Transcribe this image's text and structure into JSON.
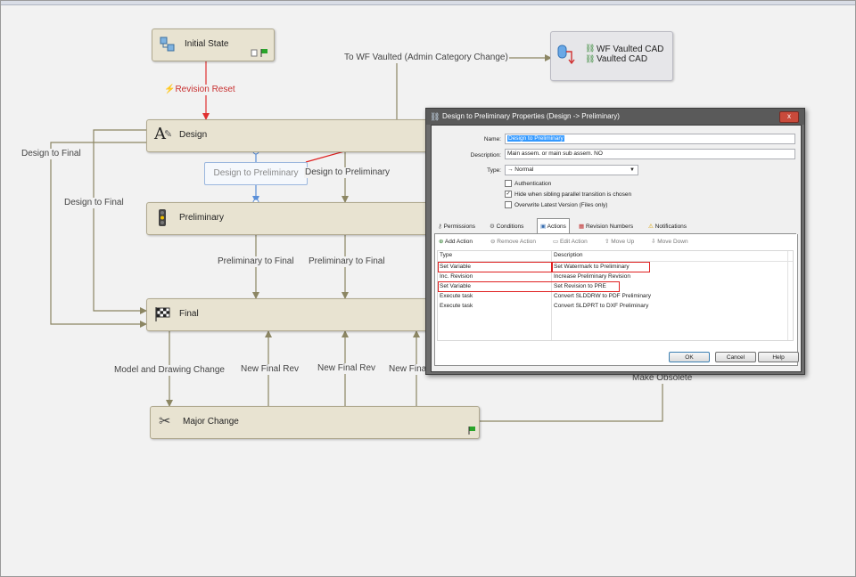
{
  "workflow": {
    "states": {
      "initial_state": "Initial State",
      "design": "Design",
      "preliminary": "Preliminary",
      "final": "Final",
      "major_change": "Major Change"
    },
    "vault_box": {
      "line1": "WF Vaulted CAD",
      "line2": "Vaulted CAD"
    },
    "transitions": {
      "revision_reset": "Revision Reset",
      "to_wf_vaulted": "To WF Vaulted (Admin Category Change)",
      "design_to_final_left": "Design to Final",
      "design_to_final_inner": "Design to Final",
      "design_to_preliminary_selected": "Design to Preliminary",
      "design_to_preliminary": "Design to Preliminary",
      "preliminary_to_final_1": "Preliminary to Final",
      "preliminary_to_final_2": "Preliminary to Final",
      "model_and_drawing_change": "Model and Drawing Change",
      "new_final_rev_1": "New Final Rev",
      "new_final_rev_2": "New Final Rev",
      "new_final_rev_3": "New Fina",
      "make_obsolete": "Make Obsolete"
    },
    "colors": {
      "state_fill": "#e8e3d1",
      "connector": "#8c8663",
      "revision_reset": "#e03030",
      "highlight": "#e02020",
      "selection": "#5a8fd8"
    }
  },
  "dialog": {
    "title": "Design to Preliminary Properties (Design -> Preliminary)",
    "close_label": "x",
    "fields": {
      "name_label": "Name:",
      "name_value": "Design to Preliminary",
      "description_label": "Description:",
      "description_value": "Main assem. or main sub assem. NO",
      "type_label": "Type:",
      "type_value": "→ Normal"
    },
    "checkboxes": [
      {
        "label": "Authentication",
        "checked": false
      },
      {
        "label": "Hide when sibling parallel transition is chosen",
        "checked": true
      },
      {
        "label": "Overwrite Latest Version (Files only)",
        "checked": false
      }
    ],
    "tabs": [
      "Permissions",
      "Conditions",
      "Actions",
      "Revision Numbers",
      "Notifications"
    ],
    "active_tab": "Actions",
    "toolbar": [
      "Add Action",
      "Remove Action",
      "Edit Action",
      "Move Up",
      "Move Down"
    ],
    "grid": {
      "columns": [
        "Type",
        "Description"
      ],
      "rows": [
        {
          "type": "Set Variable",
          "description": "Set Watermark to Preliminary",
          "highlighted": true
        },
        {
          "type": "Inc. Revision",
          "description": "Increase Preliminary Revision",
          "highlighted": false
        },
        {
          "type": "Set Variable",
          "description": "Set Revision to PRE",
          "highlighted": true
        },
        {
          "type": "Execute task",
          "description": "Convert SLDDRW to PDF Preliminary",
          "highlighted": false
        },
        {
          "type": "Execute task",
          "description": "Convert SLDPRT to DXF Preliminary",
          "highlighted": false
        }
      ]
    },
    "buttons": {
      "ok": "OK",
      "cancel": "Cancel",
      "help": "Help"
    }
  }
}
